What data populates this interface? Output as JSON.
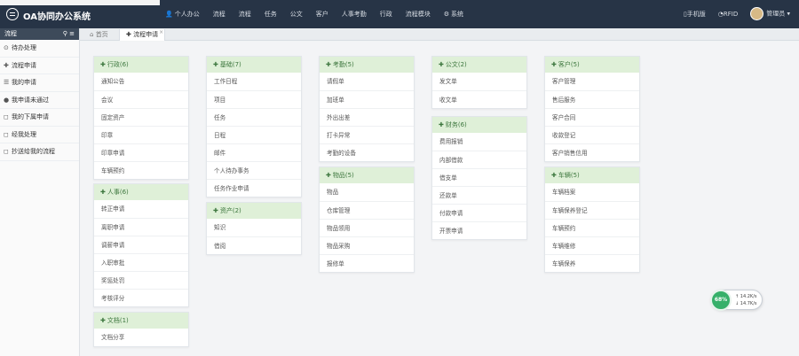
{
  "header": {
    "title": "OA协同办公系统",
    "nav": [
      {
        "icon": "user-icon",
        "glyph": "👤",
        "label": "个人办公"
      },
      {
        "icon": "",
        "glyph": "",
        "label": "流程"
      },
      {
        "icon": "",
        "glyph": "",
        "label": "流程"
      },
      {
        "icon": "",
        "glyph": "",
        "label": "任务"
      },
      {
        "icon": "",
        "glyph": "",
        "label": "公文"
      },
      {
        "icon": "",
        "glyph": "",
        "label": "客户"
      },
      {
        "icon": "",
        "glyph": "",
        "label": "人事考勤"
      },
      {
        "icon": "",
        "glyph": "",
        "label": "行政"
      },
      {
        "icon": "",
        "glyph": "",
        "label": "流程模块"
      },
      {
        "icon": "gear-icon",
        "glyph": "⚙",
        "label": "系统"
      }
    ],
    "right": {
      "mobile": "手机版",
      "rfid": "RFID",
      "user": "管理员"
    }
  },
  "sidebar": {
    "title": "流程",
    "items": [
      {
        "icon": "circle-icon",
        "glyph": "⊙",
        "label": "待办处理"
      },
      {
        "icon": "plus-icon",
        "glyph": "✚",
        "label": "流程申请"
      },
      {
        "icon": "list-icon",
        "glyph": "☰",
        "label": "我的申请"
      },
      {
        "icon": "info-icon",
        "glyph": "●",
        "label": "我申请未通过"
      },
      {
        "icon": "bookmark-icon",
        "glyph": "◻",
        "label": "我的下属申请"
      },
      {
        "icon": "bookmark-icon",
        "glyph": "◻",
        "label": "经我处理"
      },
      {
        "icon": "bookmark-icon",
        "glyph": "◻",
        "label": "抄送给我的流程"
      }
    ]
  },
  "tabs": {
    "home": "首页",
    "active": "流程申请",
    "close": "×"
  },
  "cards": [
    {
      "title": "行政(6)",
      "items": [
        "通知公告",
        "会议",
        "固定资产",
        "印章",
        "印章申请",
        "车辆预约"
      ]
    },
    {
      "title": "人事(6)",
      "items": [
        "转正申请",
        "离职申请",
        "调薪申请",
        "入职审批",
        "奖惩处罚",
        "考核评分"
      ]
    },
    {
      "title": "文档(1)",
      "items": [
        "文档分享"
      ]
    },
    {
      "title": "基础(7)",
      "items": [
        "工作日程",
        "项目",
        "任务",
        "日程",
        "邮件",
        "个人待办事务",
        "任务作业申请"
      ]
    },
    {
      "title": "资产(2)",
      "items": [
        "知识",
        "借阅"
      ]
    },
    {
      "title": "考勤(5)",
      "items": [
        "请假单",
        "加班单",
        "外出出差",
        "打卡异常",
        "考勤的设备"
      ]
    },
    {
      "title": "物品(5)",
      "items": [
        "物品",
        "仓库管理",
        "物品领用",
        "物品采购",
        "报修单"
      ]
    },
    {
      "title": "公文(2)",
      "items": [
        "发文单",
        "收文单"
      ]
    },
    {
      "title": "财务(6)",
      "items": [
        "费用报销",
        "内部借款",
        "借支单",
        "还款单",
        "付款申请",
        "开票申请"
      ]
    },
    {
      "title": "客户(5)",
      "items": [
        "客户管理",
        "售后服务",
        "客户合同",
        "收款登记",
        "客户销售信用"
      ]
    },
    {
      "title": "车辆(5)",
      "items": [
        "车辆档案",
        "车辆保养登记",
        "车辆预约",
        "车辆维修",
        "车辆保养"
      ]
    }
  ],
  "widget": {
    "percent": "68%",
    "up": "14.2K/s",
    "down": "14.7K/s"
  }
}
